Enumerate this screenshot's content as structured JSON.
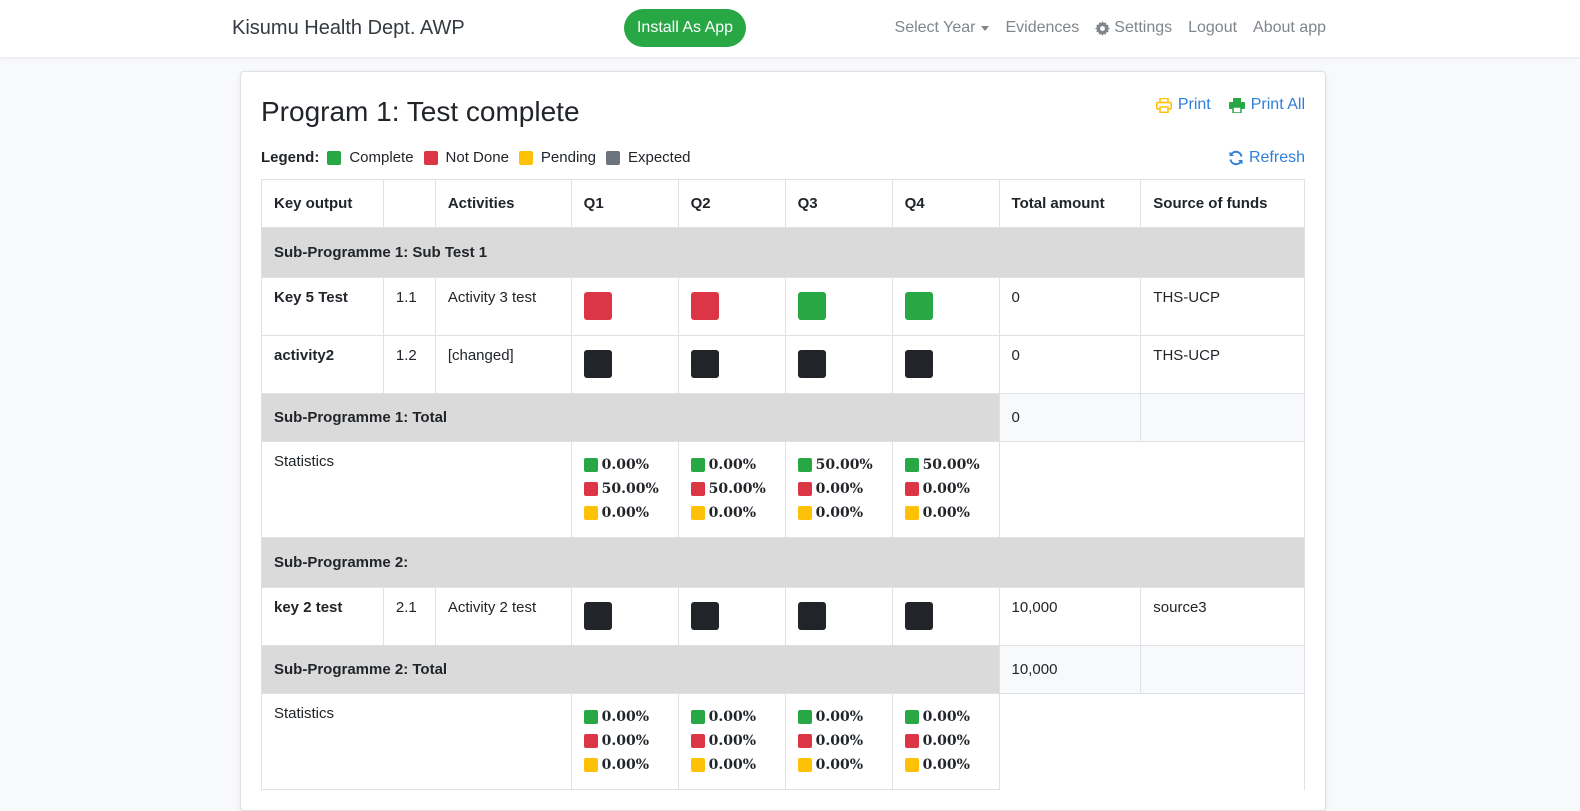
{
  "nav": {
    "brand": "Kisumu Health Dept. AWP",
    "install_label": "Install As App",
    "links": {
      "select_year": "Select Year",
      "evidences": "Evidences",
      "settings": "Settings",
      "logout": "Logout",
      "about": "About app"
    }
  },
  "page": {
    "title": "Program 1: Test complete",
    "print_label": "Print",
    "print_all_label": "Print All",
    "refresh_label": "Refresh"
  },
  "legend": {
    "title": "Legend:",
    "complete": "Complete",
    "not_done": "Not Done",
    "pending": "Pending",
    "expected": "Expected"
  },
  "colors": {
    "complete": "#28a745",
    "not_done": "#dc3545",
    "pending": "#ffc107",
    "expected": "#212529",
    "link": "#2f7ed8"
  },
  "table": {
    "headers": [
      "Key output",
      "",
      "Activities",
      "Q1",
      "Q2",
      "Q3",
      "Q4",
      "Total amount",
      "Source of funds"
    ],
    "sub1": {
      "title": "Sub-Programme 1: Sub Test 1",
      "rows": [
        {
          "key": "Key 5 Test",
          "num": "1.1",
          "activity": "Activity 3 test",
          "q": [
            "not_done",
            "not_done",
            "complete",
            "complete"
          ],
          "amount": "0",
          "source": "THS-UCP"
        },
        {
          "key": "activity2",
          "num": "1.2",
          "activity": "[changed]",
          "q": [
            "expected",
            "expected",
            "expected",
            "expected"
          ],
          "amount": "0",
          "source": "THS-UCP"
        }
      ],
      "total_label": "Sub-Programme 1: Total",
      "total_amount": "0",
      "stats_label": "Statistics",
      "stats": [
        {
          "complete": "0.00%",
          "not_done": "50.00%",
          "pending": "0.00%"
        },
        {
          "complete": "0.00%",
          "not_done": "50.00%",
          "pending": "0.00%"
        },
        {
          "complete": "50.00%",
          "not_done": "0.00%",
          "pending": "0.00%"
        },
        {
          "complete": "50.00%",
          "not_done": "0.00%",
          "pending": "0.00%"
        }
      ]
    },
    "sub2": {
      "title": "Sub-Programme 2:",
      "rows": [
        {
          "key": "key 2 test",
          "num": "2.1",
          "activity": "Activity 2 test",
          "q": [
            "expected",
            "expected",
            "expected",
            "expected"
          ],
          "amount": "10,000",
          "source": "source3"
        }
      ],
      "total_label": "Sub-Programme 2: Total",
      "total_amount": "10,000",
      "stats_label": "Statistics",
      "stats": [
        {
          "complete": "0.00%",
          "not_done": "0.00%",
          "pending": "0.00%"
        },
        {
          "complete": "0.00%",
          "not_done": "0.00%",
          "pending": "0.00%"
        },
        {
          "complete": "0.00%",
          "not_done": "0.00%",
          "pending": "0.00%"
        },
        {
          "complete": "0.00%",
          "not_done": "0.00%",
          "pending": "0.00%"
        }
      ]
    }
  }
}
